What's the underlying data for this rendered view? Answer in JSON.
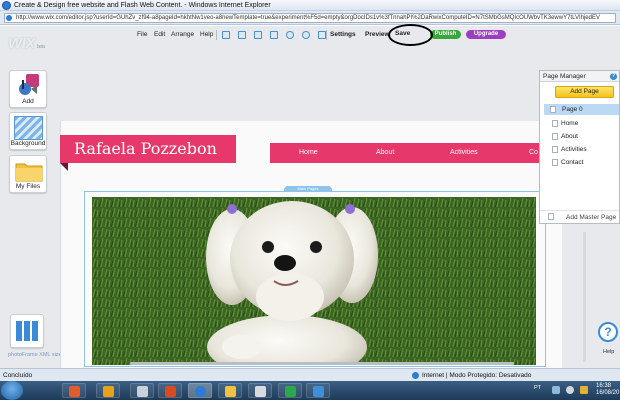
{
  "window": {
    "title": "Create & Design free website and Flash Web Content. - Windows Internet Explorer",
    "url": "http://www.wix.com/editor.jsp?userId=GUhZv_zf94-a8pageId=hkhtNw1veo-a8newTemplate=true&experiment%F5d=empty&orgDocIDs1v%3fTnnahPI%2DaRwixComputeID=N7tSMbGsMQIcOUWbvTK3ewwY7tLVIhjedEV"
  },
  "wix_logo": {
    "text": "WIX",
    "suffix": "beta"
  },
  "toolbar": {
    "file": "File",
    "edit": "Edit",
    "arrange": "Arrange",
    "help": "Help",
    "settings": "Settings",
    "preview": "Preview",
    "save": "Save",
    "publish": "Publish",
    "upgrade": "Upgrade"
  },
  "left_panel": {
    "add": "Add",
    "background": "Background",
    "my_files": "My Files",
    "footer": "photoFrame XML size: 16k"
  },
  "site": {
    "title": "Rafaela Pozzebon",
    "nav": [
      "Home",
      "About",
      "Activities",
      "Co"
    ],
    "strip_label": "Main Pages"
  },
  "page_manager": {
    "title": "Page Manager",
    "help": "?",
    "add_page": "Add Page",
    "root": "Page 0",
    "pages": [
      "Home",
      "About",
      "Activities",
      "Contact"
    ],
    "add_master": "Add Master Page"
  },
  "help_widget": {
    "symbol": "?",
    "label": "Help"
  },
  "status": {
    "left": "Concluído",
    "zone": "Internet | Modo Protegido: Desativado"
  },
  "taskbar": {
    "lang": "PT",
    "time": "16:38",
    "date": "16/08/20"
  },
  "colors": {
    "brand_pink": "#e6386a",
    "publish_green": "#3aa53a",
    "upgrade_purple": "#9b3fbf",
    "accent_blue": "#3a8ad8"
  }
}
